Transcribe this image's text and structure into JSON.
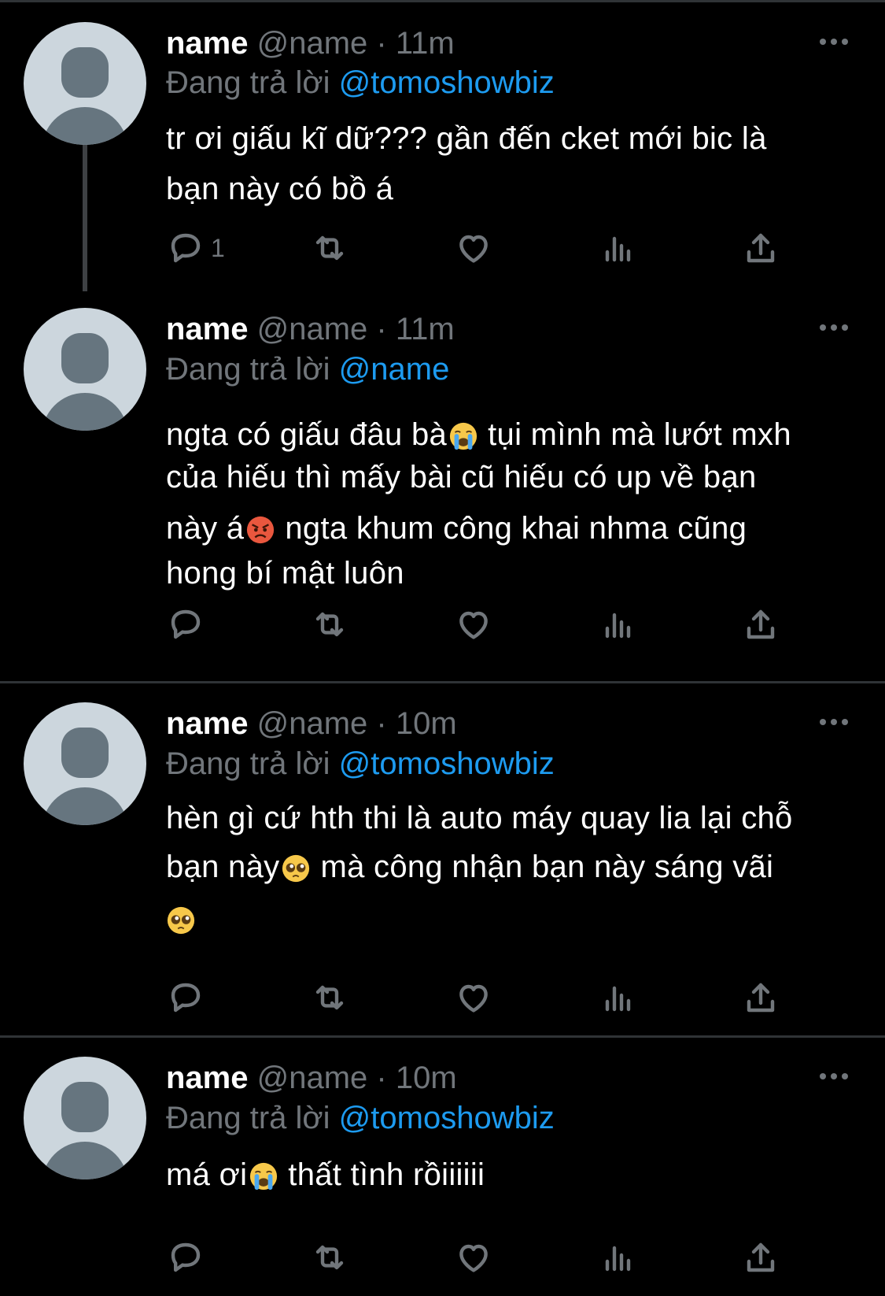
{
  "tweets": [
    {
      "name": "name",
      "handle": "@name",
      "dot": "·",
      "time": "11m",
      "reply_prefix": "Đang trả lời",
      "reply_to": "@tomoshowbiz",
      "lines": [
        "tr ơi giấu kĩ dữ??? gần đến cket mới bic là",
        "bạn này có bồ á"
      ],
      "reply_count": "1"
    },
    {
      "name": "name",
      "handle": "@name",
      "dot": "·",
      "time": "11m",
      "reply_prefix": "Đang trả lời",
      "reply_to": "@name",
      "segments": {
        "l1a": "ngta có giấu đâu bà",
        "l1b": "tụi mình mà lướt mxh",
        "l2": "của hiếu thì mấy bài cũ hiếu có up về bạn",
        "l3a": "này á",
        "l3b": "ngta khum công khai nhma cũng",
        "l4": "hong bí mật luôn"
      },
      "reply_count": ""
    },
    {
      "name": "name",
      "handle": "@name",
      "dot": "·",
      "time": "10m",
      "reply_prefix": "Đang trả lời",
      "reply_to": "@tomoshowbiz",
      "segments": {
        "l1": "hèn gì cứ hth thi là auto máy quay lia lại chỗ",
        "l2a": "bạn này",
        "l2b": "mà công nhận bạn này sáng vãi"
      },
      "reply_count": ""
    },
    {
      "name": "name",
      "handle": "@name",
      "dot": "·",
      "time": "10m",
      "reply_prefix": "Đang trả lời",
      "reply_to": "@tomoshowbiz",
      "segments": {
        "l1a": "má ơi",
        "l1b": "thất tình rồiiiiii"
      },
      "reply_count": ""
    }
  ],
  "icons": {
    "reply": "reply-icon",
    "retweet": "retweet-icon",
    "like": "heart-icon",
    "views": "analytics-icon",
    "share": "share-icon",
    "more": "more-icon"
  },
  "colors": {
    "background": "#000000",
    "text": "#ffffff",
    "secondary": "#71767b",
    "mention": "#1d9bf0",
    "divider": "#2f3336"
  }
}
